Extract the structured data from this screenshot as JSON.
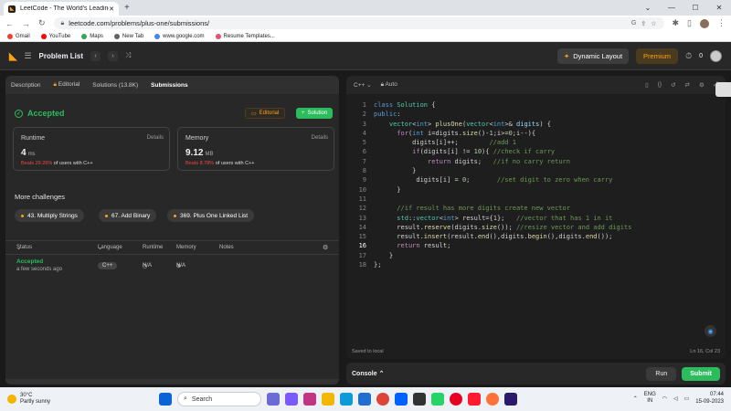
{
  "browser": {
    "tab_title": "LeetCode - The World's Leading",
    "url": "leetcode.com/problems/plus-one/submissions/",
    "bookmarks": [
      {
        "label": "Gmail",
        "color": "#ea4335"
      },
      {
        "label": "YouTube",
        "color": "#ff0000"
      },
      {
        "label": "Maps",
        "color": "#34a853"
      },
      {
        "label": "New Tab",
        "color": "#5f6368"
      },
      {
        "label": "www.google.com",
        "color": "#4285f4"
      },
      {
        "label": "Resume Templates...",
        "color": "#e94e77"
      }
    ]
  },
  "nav": {
    "problem_list": "Problem List",
    "dynamic_layout": "Dynamic Layout",
    "premium": "Premium",
    "streak": "0"
  },
  "left": {
    "tabs": [
      "Description",
      "Editorial",
      "Solutions (13.8K)",
      "Submissions"
    ],
    "status": "Accepted",
    "editorial_btn": "Editorial",
    "solution_btn": "Solution",
    "runtime": {
      "label": "Runtime",
      "details": "Details",
      "value": "4",
      "unit": "ms",
      "beats_pct": "Beats 29.26%",
      "beats_rest": "of users with C++"
    },
    "memory": {
      "label": "Memory",
      "details": "Details",
      "value": "9.12",
      "unit": "MB",
      "beats_pct": "Beats 8.78%",
      "beats_rest": "of users with C++"
    },
    "more_challenges": "More challenges",
    "challenges": [
      "43. Multiply Strings",
      "67. Add Binary",
      "369. Plus One Linked List"
    ],
    "table": {
      "headers": [
        "Status",
        "Language",
        "Runtime",
        "Memory",
        "Notes"
      ],
      "row": {
        "status": "Accepted",
        "time": "a few seconds ago",
        "language": "C++",
        "runtime": "N/A",
        "memory": "N/A"
      }
    }
  },
  "editor": {
    "language": "C++",
    "autosave": "Auto",
    "saved": "Saved to local",
    "position": "Ln 16, Col 23",
    "current_line": 16,
    "lines": [
      [
        [
          "kw",
          "class "
        ],
        [
          "ty",
          "Solution"
        ],
        [
          "tx",
          " {"
        ]
      ],
      [
        [
          "kw",
          "public"
        ],
        [
          "tx",
          ":"
        ]
      ],
      [
        [
          "tx",
          "    "
        ],
        [
          "ty",
          "vector"
        ],
        [
          "tx",
          "<"
        ],
        [
          "kw",
          "int"
        ],
        [
          "tx",
          "> "
        ],
        [
          "fn",
          "plusOne"
        ],
        [
          "tx",
          "("
        ],
        [
          "ty",
          "vector"
        ],
        [
          "tx",
          "<"
        ],
        [
          "kw",
          "int"
        ],
        [
          "tx",
          ">& "
        ],
        [
          "var",
          "digits"
        ],
        [
          "tx",
          ") {"
        ]
      ],
      [
        [
          "tx",
          "      "
        ],
        [
          "ctl",
          "for"
        ],
        [
          "tx",
          "("
        ],
        [
          "kw",
          "int"
        ],
        [
          "tx",
          " i=digits."
        ],
        [
          "fn",
          "size"
        ],
        [
          "tx",
          "()-"
        ],
        [
          "num",
          "1"
        ],
        [
          "tx",
          ";i>="
        ],
        [
          "num",
          "0"
        ],
        [
          "tx",
          ";i--){"
        ]
      ],
      [
        [
          "tx",
          "          digits[i]++;        "
        ],
        [
          "cm",
          "//add 1"
        ]
      ],
      [
        [
          "tx",
          "          "
        ],
        [
          "ctl",
          "if"
        ],
        [
          "tx",
          "(digits[i] != "
        ],
        [
          "num",
          "10"
        ],
        [
          "tx",
          "){ "
        ],
        [
          "cm",
          "//check if carry"
        ]
      ],
      [
        [
          "tx",
          "              "
        ],
        [
          "ctl",
          "return"
        ],
        [
          "tx",
          " digits;   "
        ],
        [
          "cm",
          "//if no carry return"
        ]
      ],
      [
        [
          "tx",
          "          }"
        ]
      ],
      [
        [
          "tx",
          "           digits[i] = "
        ],
        [
          "num",
          "0"
        ],
        [
          "tx",
          ";       "
        ],
        [
          "cm",
          "//set digit to zero when carry"
        ]
      ],
      [
        [
          "tx",
          "      }"
        ]
      ],
      [
        [
          "tx",
          ""
        ]
      ],
      [
        [
          "tx",
          "      "
        ],
        [
          "cm",
          "//if result has more digits create new vector"
        ]
      ],
      [
        [
          "tx",
          "      "
        ],
        [
          "ty",
          "std"
        ],
        [
          "tx",
          "::"
        ],
        [
          "ty",
          "vector"
        ],
        [
          "tx",
          "<"
        ],
        [
          "kw",
          "int"
        ],
        [
          "tx",
          "> result={"
        ],
        [
          "num",
          "1"
        ],
        [
          "tx",
          "};   "
        ],
        [
          "cm",
          "//vector that has 1 in it"
        ]
      ],
      [
        [
          "tx",
          "      result."
        ],
        [
          "fn",
          "reserve"
        ],
        [
          "tx",
          "(digits."
        ],
        [
          "fn",
          "size"
        ],
        [
          "tx",
          "()); "
        ],
        [
          "cm",
          "//resize vector and add digits"
        ]
      ],
      [
        [
          "tx",
          "      result."
        ],
        [
          "fn",
          "insert"
        ],
        [
          "tx",
          "(result."
        ],
        [
          "fn",
          "end"
        ],
        [
          "tx",
          "(),digits."
        ],
        [
          "fn",
          "begin"
        ],
        [
          "tx",
          "(),digits."
        ],
        [
          "fn",
          "end"
        ],
        [
          "tx",
          "());"
        ]
      ],
      [
        [
          "tx",
          "      "
        ],
        [
          "ctl",
          "return"
        ],
        [
          "tx",
          " result;"
        ]
      ],
      [
        [
          "tx",
          "    }"
        ]
      ],
      [
        [
          "tx",
          "};"
        ]
      ]
    ],
    "console": "Console",
    "run": "Run",
    "submit": "Submit"
  },
  "taskbar": {
    "temp": "30°C",
    "weather": "Partly sunny",
    "search": "Search",
    "lang": "ENG",
    "region": "IN",
    "time": "07:44",
    "date": "15-09-2023"
  }
}
